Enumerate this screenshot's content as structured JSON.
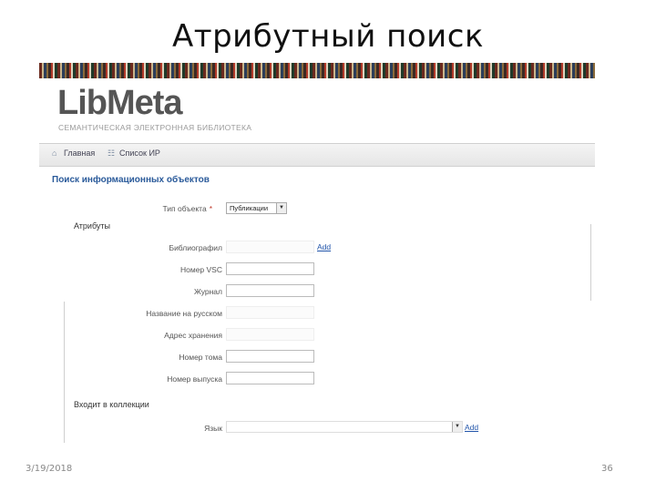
{
  "slide": {
    "title": "Атрибутный поиск",
    "date": "3/19/2018",
    "page_number": "36"
  },
  "app": {
    "logo": "LibMeta",
    "subtitle": "СЕМАНТИЧЕСКАЯ ЭЛЕКТРОННАЯ БИБЛИОТЕКА"
  },
  "nav": {
    "items": [
      {
        "label": "Главная",
        "icon": "home-icon"
      },
      {
        "label": "Список ИР",
        "icon": "list-icon"
      }
    ]
  },
  "page": {
    "heading": "Поиск информационных объектов"
  },
  "form": {
    "type_label": "Тип объекта",
    "type_required_mark": "*",
    "type_value": "Публикации",
    "attributes_section": "Атрибуты",
    "fields": [
      {
        "label": "Библиографил",
        "value": "",
        "style": "flat"
      },
      {
        "label": "Номер VSC",
        "value": "",
        "style": "box"
      },
      {
        "label": "Журнал",
        "value": "",
        "style": "box"
      },
      {
        "label": "Название на русском",
        "value": "",
        "style": "flat"
      },
      {
        "label": "Адрес хранения",
        "value": "",
        "style": "flat"
      },
      {
        "label": "Номер тома",
        "value": "",
        "style": "box"
      },
      {
        "label": "Номер выпуска",
        "value": "",
        "style": "box"
      }
    ],
    "add_link": "Add",
    "collection_section": "Входит в коллекции",
    "language_label": "Язык",
    "language_value": "",
    "language_add_link": "Add"
  },
  "colors": {
    "heading": "#2a5a9a",
    "link": "#2255aa",
    "required": "#c0392b"
  }
}
